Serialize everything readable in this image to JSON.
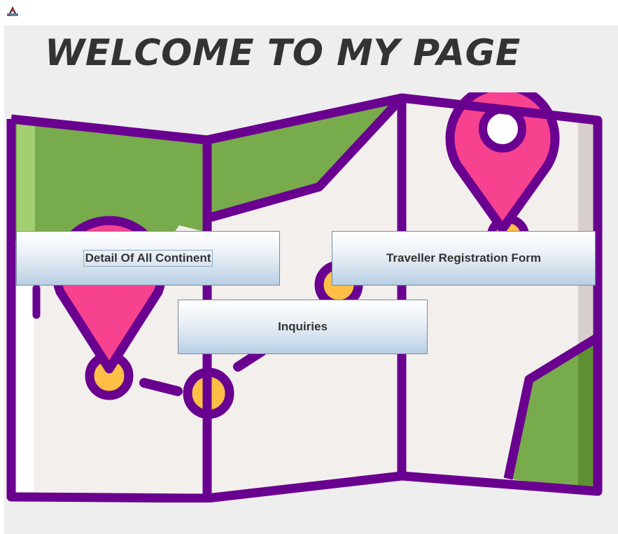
{
  "window": {
    "app_icon": "java-duke-icon"
  },
  "main": {
    "heading": "WELCOME TO MY PAGE",
    "background_image": "folded-map-with-location-pins-illustration"
  },
  "buttons": {
    "continents": "Detail Of All Continent",
    "registration": "Traveller Registration Form",
    "inquiries": "Inquiries"
  },
  "colors": {
    "map_outline": "#6a0090",
    "map_green": "#78ab4c",
    "map_paper": "#f3efed",
    "pin_pink": "#f7428f",
    "pin_yellow": "#ffbf47",
    "button_top": "#ffffff",
    "button_bottom": "#b8cfe5",
    "panel_background": "#eeeeee"
  }
}
